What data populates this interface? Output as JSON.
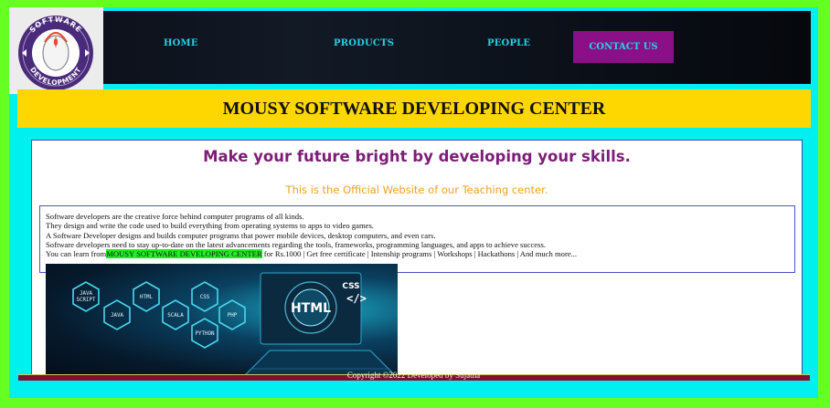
{
  "logo": {
    "text_top": "SOFTWARE",
    "text_bottom": "DEVELOPMENT"
  },
  "nav": {
    "home": "HOME",
    "products": "PRODUCTS",
    "people": "PEOPLE",
    "contact": "CONTACT US"
  },
  "banner": {
    "title": "MOUSY SOFTWARE DEVELOPING CENTER"
  },
  "main": {
    "heading": "Make your future bright by developing your skills.",
    "subheading": "This is the Official Website of our Teaching center.",
    "paragraphs": [
      "Software developers are the creative force behind computer programs of all kinds.",
      "They design and write the code used to build everything from operating systems to apps to video games.",
      "A Software Developer designs and builds computer programs that power mobile devices, desktop computers, and even cars.",
      "Software developers need to stay up-to-date on the latest advancements regarding the tools, frameworks, programming languages, and apps to achieve success."
    ],
    "learn_prefix": "You can learn from",
    "learn_highlight": "MOUSY SOFTWARE DEVELOPING CENTER",
    "learn_suffix": " for Rs.1000 | Get free certificate | Intenship programs | Workshops | Hackathons | And much more..."
  },
  "image": {
    "hex_labels": [
      "JAVA SCRIPT",
      "JAVA",
      "HTML",
      "SCALA",
      "CSS",
      "PHP",
      "PYTHON"
    ],
    "screen_html": "HTML",
    "screen_css": "CSS",
    "screen_tag": "</>"
  },
  "footer": {
    "text": "Copyright ©2022 Developed by Sujatha"
  },
  "colors": {
    "outer_border": "#66ff22",
    "frame": "#00f0f0",
    "banner": "#ffd700",
    "heading": "#7d1d78",
    "subheading": "#f0a020",
    "highlight": "#22ee22",
    "contact_bg": "#8b0f86",
    "nav_text": "#21d4e6"
  }
}
